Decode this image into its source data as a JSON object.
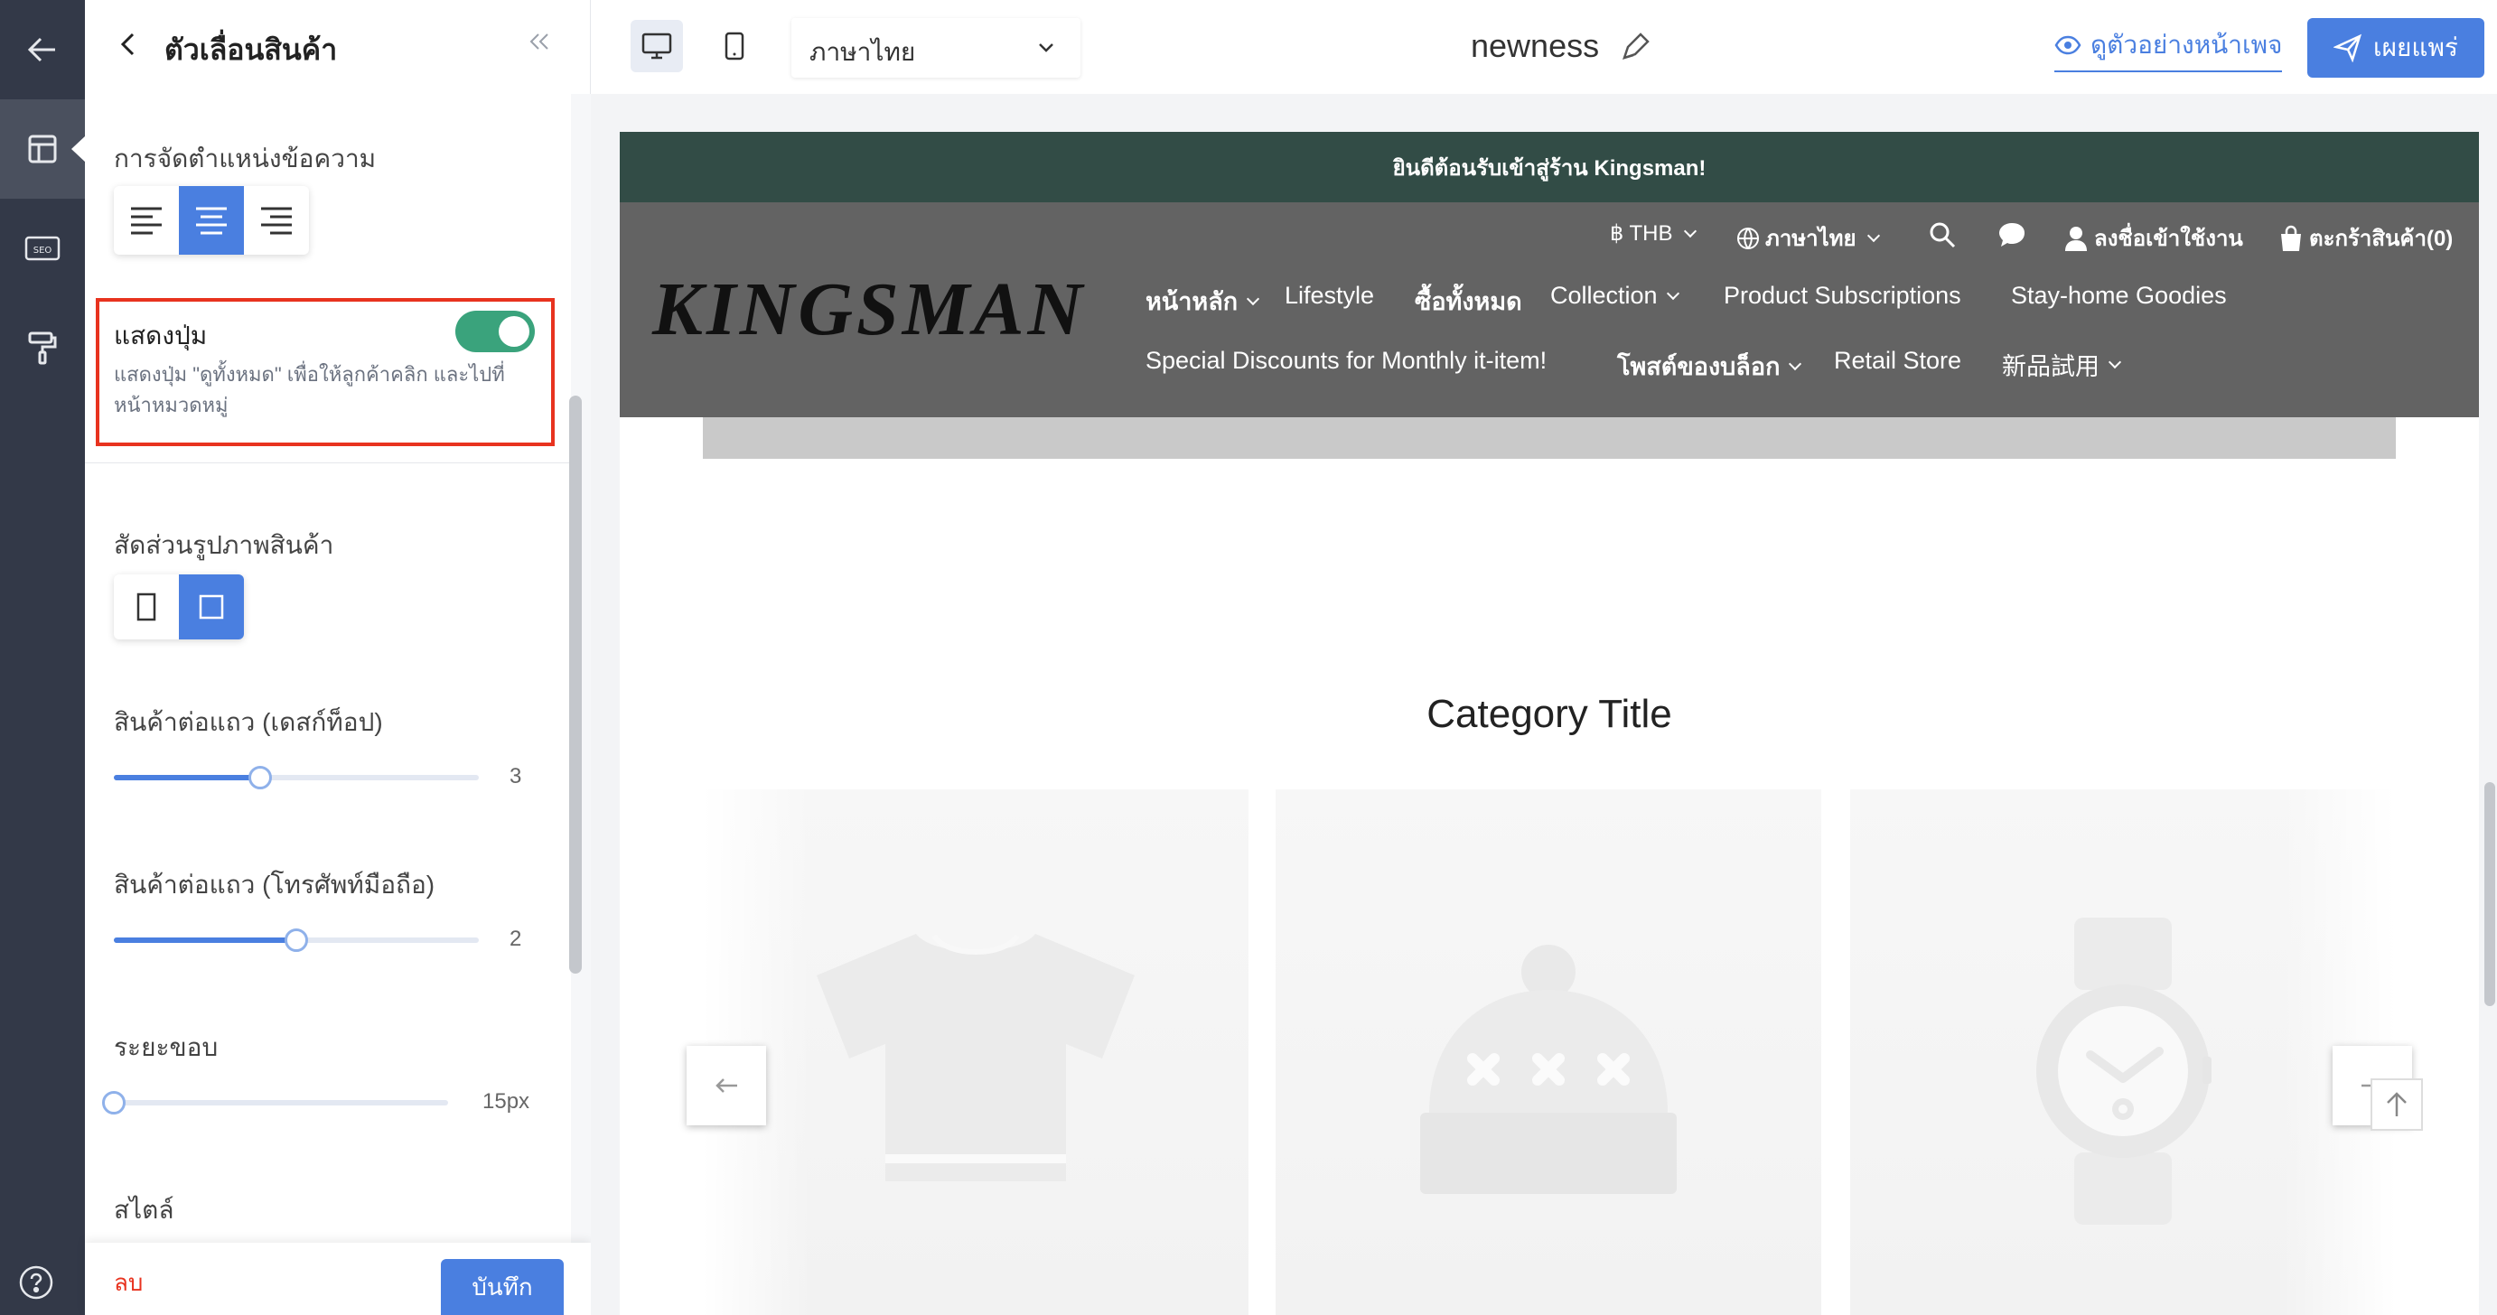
{
  "panel": {
    "title": "ตัวเลื่อนสินค้า",
    "text_alignment_label": "การจัดตำแหน่งข้อความ",
    "show_button_label": "แสดงปุ่ม",
    "show_button_enabled": true,
    "show_button_desc": "แสดงปุ่ม \"ดูทั้งหมด\" เพื่อให้ลูกค้าคลิก และไปที่หน้าหมวดหมู่",
    "image_ratio_label": "สัดส่วนรูปภาพสินค้า",
    "desktop_per_row_label": "สินค้าต่อแถว (เดสก์ท็อป)",
    "desktop_per_row_value": "3",
    "desktop_per_row_fraction": 0.4,
    "mobile_per_row_label": "สินค้าต่อแถว (โทรศัพท์มือถือ)",
    "mobile_per_row_value": "2",
    "mobile_per_row_fraction": 0.5,
    "padding_label": "ระยะขอบ",
    "padding_value": "15px",
    "padding_fraction": 0.0,
    "style_label": "สไตล์",
    "delete_label": "ลบ",
    "save_label": "บันทึก"
  },
  "topbar": {
    "language": "ภาษาไทย",
    "page_name": "newness",
    "preview_label": "ดูตัวอย่างหน้าเพจ",
    "publish_label": "เผยแพร่"
  },
  "site": {
    "announcement": "ยินดีต้อนรับเข้าสู่ร้าน Kingsman!",
    "logo": "KINGSMAN",
    "currency": "฿ THB",
    "language": "ภาษาไทย",
    "login": "ลงชื่อเข้าใช้งาน",
    "cart": "ตะกร้าสินค้า(0)",
    "nav": {
      "home": "หน้าหลัก",
      "lifestyle": "Lifestyle",
      "shop_all": "ซื้อทั้งหมด",
      "collection": "Collection",
      "subscriptions": "Product Subscriptions",
      "stay_home": "Stay-home Goodies",
      "special": "Special Discounts for Monthly it-item!",
      "blog": "โพสต์ของบล็อก",
      "retail": "Retail Store",
      "trial": "新品試用"
    },
    "category_title": "Category Title"
  },
  "colors": {
    "accent": "#4a7fe0",
    "toggle_on": "#3aa37c",
    "highlight": "#e8331f",
    "announce_bg": "#324c46",
    "header_bg": "#636363",
    "rail_bg": "#333948"
  }
}
